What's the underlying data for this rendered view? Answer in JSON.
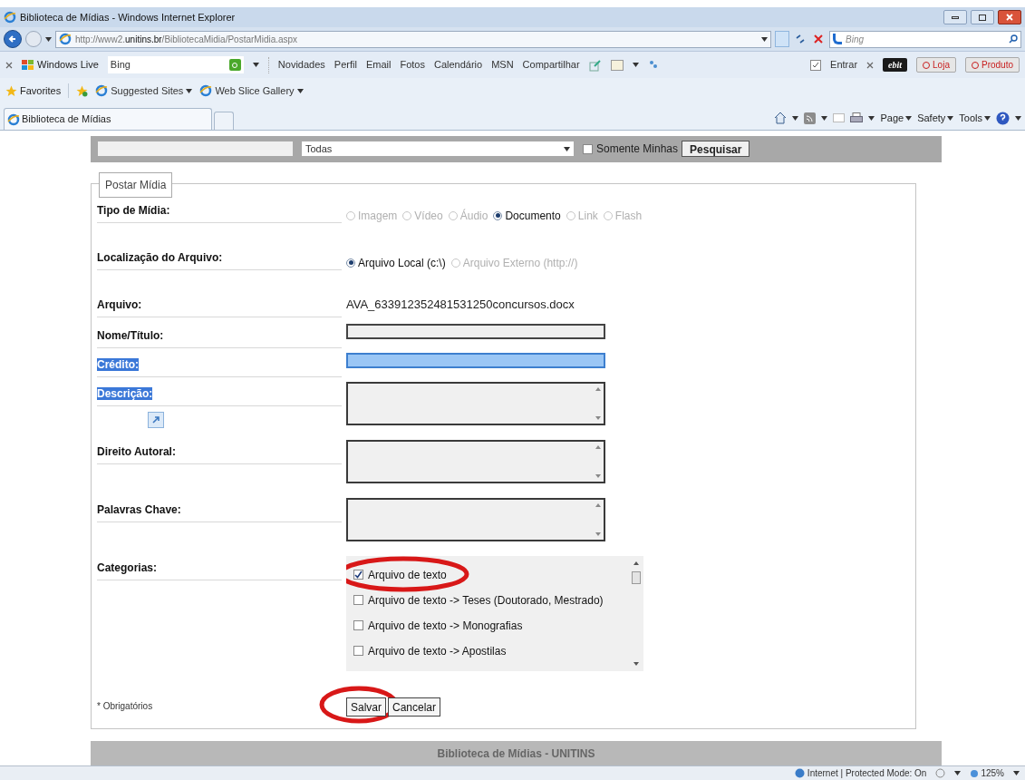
{
  "window": {
    "title": "Biblioteca de Mídias - Windows Internet Explorer"
  },
  "address_bar": {
    "url_prefix": "http://www2.",
    "url_domain": "unitins.br",
    "url_path": "/BibliotecaMidia/PostarMidia.aspx",
    "search_placeholder": "Bing"
  },
  "links_toolbar": {
    "brand": "Windows Live",
    "search_value": "Bing",
    "links": [
      "Novidades",
      "Perfil",
      "Email",
      "Fotos",
      "Calendário",
      "MSN",
      "Compartilhar"
    ],
    "sign_in": "Entrar",
    "ebit": "ebit",
    "buttons": [
      "Loja",
      "Produto"
    ]
  },
  "favorites_bar": {
    "label": "Favorites",
    "items": [
      "Suggested Sites",
      "Web Slice Gallery"
    ]
  },
  "tabs": [
    {
      "label": "Biblioteca de Mídias",
      "selected": true
    }
  ],
  "command_bar": [
    "Page",
    "Safety",
    "Tools"
  ],
  "page": {
    "search_strip": {
      "category": "Todas",
      "only_mine": "Somente Minhas",
      "only_mine_checked": false,
      "search_button": "Pesquisar"
    },
    "form": {
      "legend": "Postar Mídia",
      "rows": [
        {
          "kind": "radios",
          "label": "Tipo de Mídia:",
          "highlighted": false,
          "options": [
            {
              "label": "Imagem",
              "selected": false,
              "disabled": true
            },
            {
              "label": "Vídeo",
              "selected": false,
              "disabled": true
            },
            {
              "label": "Áudio",
              "selected": false,
              "disabled": true
            },
            {
              "label": "Documento",
              "selected": true,
              "disabled": false
            },
            {
              "label": "Link",
              "selected": false,
              "disabled": true
            },
            {
              "label": "Flash",
              "selected": false,
              "disabled": true
            }
          ]
        },
        {
          "kind": "radios",
          "label": "Localização do Arquivo:",
          "highlighted": false,
          "options": [
            {
              "label": "Arquivo Local (c:\\)",
              "selected": true,
              "disabled": false
            },
            {
              "label": "Arquivo Externo (http://)",
              "selected": false,
              "disabled": true
            }
          ]
        },
        {
          "kind": "text",
          "label": "Arquivo:",
          "highlighted": false,
          "value": "AVA_633912352481531250concursos.docx"
        },
        {
          "kind": "input",
          "label": "Nome/Título:",
          "highlighted": false
        },
        {
          "kind": "input",
          "label": "Crédito:",
          "highlighted": true
        },
        {
          "kind": "textarea",
          "label": "Descrição:",
          "highlighted": true,
          "expand_icon": true
        },
        {
          "kind": "textarea",
          "label": "Direito Autoral:",
          "highlighted": false
        },
        {
          "kind": "textarea",
          "label": "Palavras Chave:",
          "highlighted": false
        },
        {
          "kind": "checklist",
          "label": "Categorias:",
          "highlighted": false,
          "items": [
            {
              "label": "Arquivo de texto",
              "checked": true,
              "circled": true
            },
            {
              "label": "Arquivo de texto -> Teses (Doutorado, Mestrado)",
              "checked": false
            },
            {
              "label": "Arquivo de texto -> Monografias",
              "checked": false
            },
            {
              "label": "Arquivo de texto -> Apostilas",
              "checked": false
            }
          ]
        }
      ],
      "required_note": "* Obrigatórios",
      "buttons": [
        {
          "label": "Salvar",
          "circled": true
        },
        {
          "label": "Cancelar"
        }
      ]
    },
    "footer": "Biblioteca de Mídias - UNITINS"
  },
  "status_bar": {
    "zone": "Internet | Protected Mode: On",
    "zoom": "125%"
  }
}
